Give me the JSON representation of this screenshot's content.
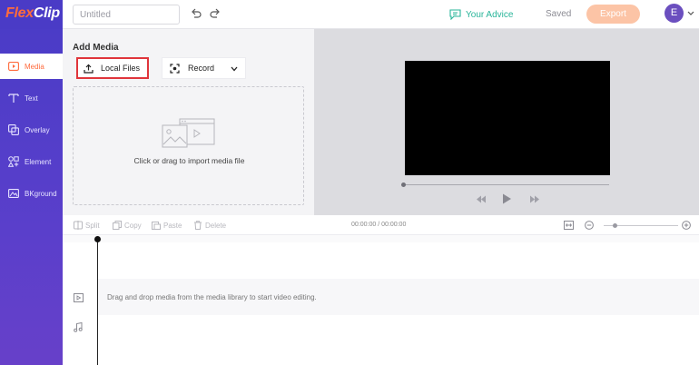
{
  "topbar": {
    "logo_flex": "Flex",
    "logo_clip": "Clip",
    "title_placeholder": "Untitled",
    "advice_label": "Your Advice",
    "saved_label": "Saved",
    "export_label": "Export",
    "avatar_initial": "E"
  },
  "sidebar": {
    "items": [
      {
        "label": "Media",
        "icon": "media-icon",
        "active": true
      },
      {
        "label": "Text",
        "icon": "text-icon",
        "active": false
      },
      {
        "label": "Overlay",
        "icon": "overlay-icon",
        "active": false
      },
      {
        "label": "Element",
        "icon": "element-icon",
        "active": false
      },
      {
        "label": "BKground",
        "icon": "background-icon",
        "active": false
      }
    ]
  },
  "media": {
    "title": "Add Media",
    "local_files_label": "Local Files",
    "record_label": "Record",
    "drop_text": "Click or drag to import media file"
  },
  "toolbar": {
    "split_label": "Split",
    "copy_label": "Copy",
    "paste_label": "Paste",
    "delete_label": "Delete",
    "timecode": "00:00:00 / 00:00:00"
  },
  "timeline": {
    "hint": "Drag and drop media from the media library to start video editing."
  },
  "colors": {
    "sidebar": "#4b3cc7",
    "accent": "#ff6b3d",
    "advice": "#29b59a",
    "export": "#fcc4a6",
    "highlight_border": "#e0353b"
  }
}
